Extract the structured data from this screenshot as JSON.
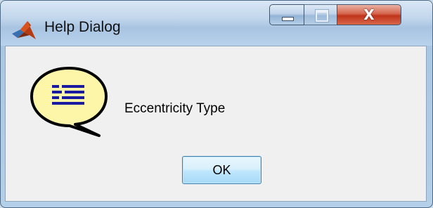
{
  "window": {
    "title": "Help Dialog",
    "controls": {
      "minimize_icon": "minimize-icon",
      "maximize_icon": "maximize-icon",
      "close_label": "X"
    }
  },
  "dialog": {
    "icon": "help-speech-bubble-icon",
    "message": "Eccentricity Type",
    "ok_label": "OK"
  },
  "colors": {
    "bubble_fill": "#fdf5a8",
    "bubble_lines": "#1a1aa0",
    "close_button": "#c8391f"
  }
}
